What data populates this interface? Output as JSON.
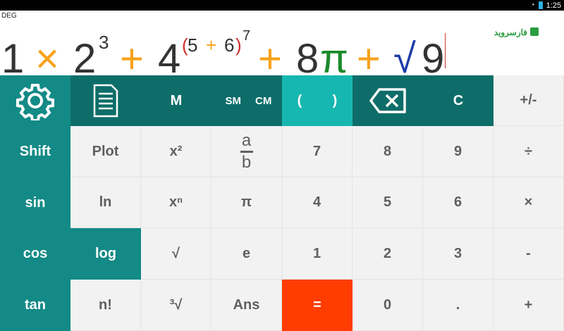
{
  "status": {
    "time": "1:25"
  },
  "display": {
    "mode": "DEG",
    "expr": {
      "one": "1",
      "times": "×",
      "two": "2",
      "exp3": "3",
      "plus1": "+",
      "four": "4",
      "paren_open": "(",
      "five": "5",
      "plus_inner": "+",
      "six": "6",
      "paren_close": ")",
      "exp7": "7",
      "plus2": "+",
      "eight": "8",
      "pi": "π",
      "plus3": "+",
      "sqrt": "√",
      "nine": "9"
    },
    "logo_text": "فارسروید"
  },
  "keys": {
    "row0": {
      "m": "M",
      "sm": "SM",
      "cm": "CM",
      "paren_open": "(",
      "paren_close": ")",
      "clear": "C",
      "plus_minus": "+/-"
    },
    "row1": {
      "shift": "Shift",
      "plot": "Plot",
      "x2": "x²",
      "frac_a": "a",
      "frac_b": "b",
      "seven": "7",
      "eight": "8",
      "nine": "9",
      "divide": "÷"
    },
    "row2": {
      "sin": "sin",
      "ln": "ln",
      "xn": "xⁿ",
      "pi": "π",
      "four": "4",
      "five": "5",
      "six": "6",
      "times": "×"
    },
    "row3": {
      "cos": "cos",
      "log": "log",
      "sqrt": "√",
      "e": "e",
      "one": "1",
      "two": "2",
      "three": "3",
      "minus": "-"
    },
    "row4": {
      "tan": "tan",
      "fact": "n!",
      "cbrt": "³√",
      "ans": "Ans",
      "equals": "=",
      "zero": "0",
      "dot": ".",
      "plus": "+"
    }
  },
  "colors": {
    "teal": "#138a86",
    "dark_teal": "#0e6d69",
    "cyan": "#17b7b1",
    "equals": "#ff3d00",
    "operator": "#f7a21b",
    "pi": "#1a8a2b",
    "sqrt": "#1a3aa8"
  }
}
